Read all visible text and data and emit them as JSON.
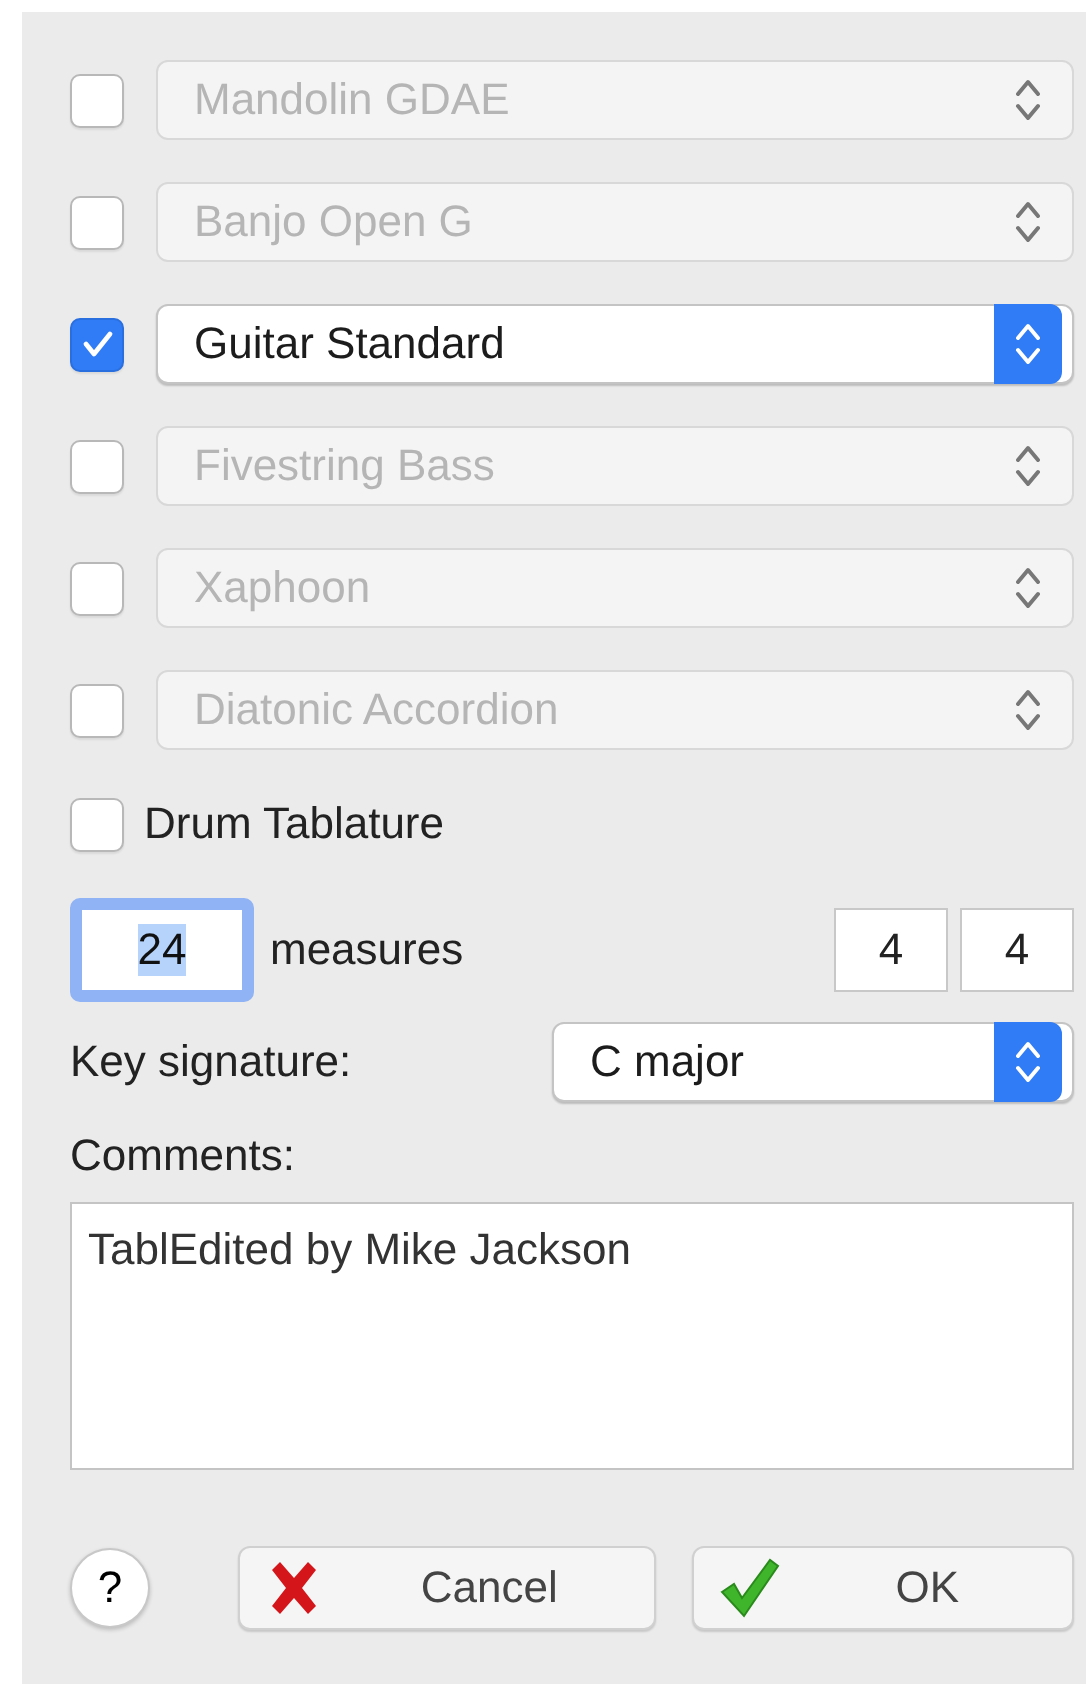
{
  "tunings": [
    {
      "label": "Mandolin GDAE",
      "checked": false
    },
    {
      "label": "Banjo Open G",
      "checked": false
    },
    {
      "label": "Guitar Standard",
      "checked": true
    },
    {
      "label": "Fivestring Bass",
      "checked": false
    },
    {
      "label": "Xaphoon",
      "checked": false
    },
    {
      "label": "Diatonic Accordion",
      "checked": false
    }
  ],
  "drum_tablature": {
    "label": "Drum Tablature",
    "checked": false
  },
  "measures": {
    "value": "24",
    "label": "measures",
    "focused": true
  },
  "time_signature": [
    "4",
    "4"
  ],
  "key_signature": {
    "label": "Key signature:",
    "value": "C major"
  },
  "comments": {
    "label": "Comments:",
    "value": "TablEdited by Mike Jackson"
  },
  "buttons": [
    {
      "label": "?",
      "kind": "help"
    },
    {
      "label": "Cancel",
      "kind": "cancel"
    },
    {
      "label": "OK",
      "kind": "ok"
    }
  ]
}
